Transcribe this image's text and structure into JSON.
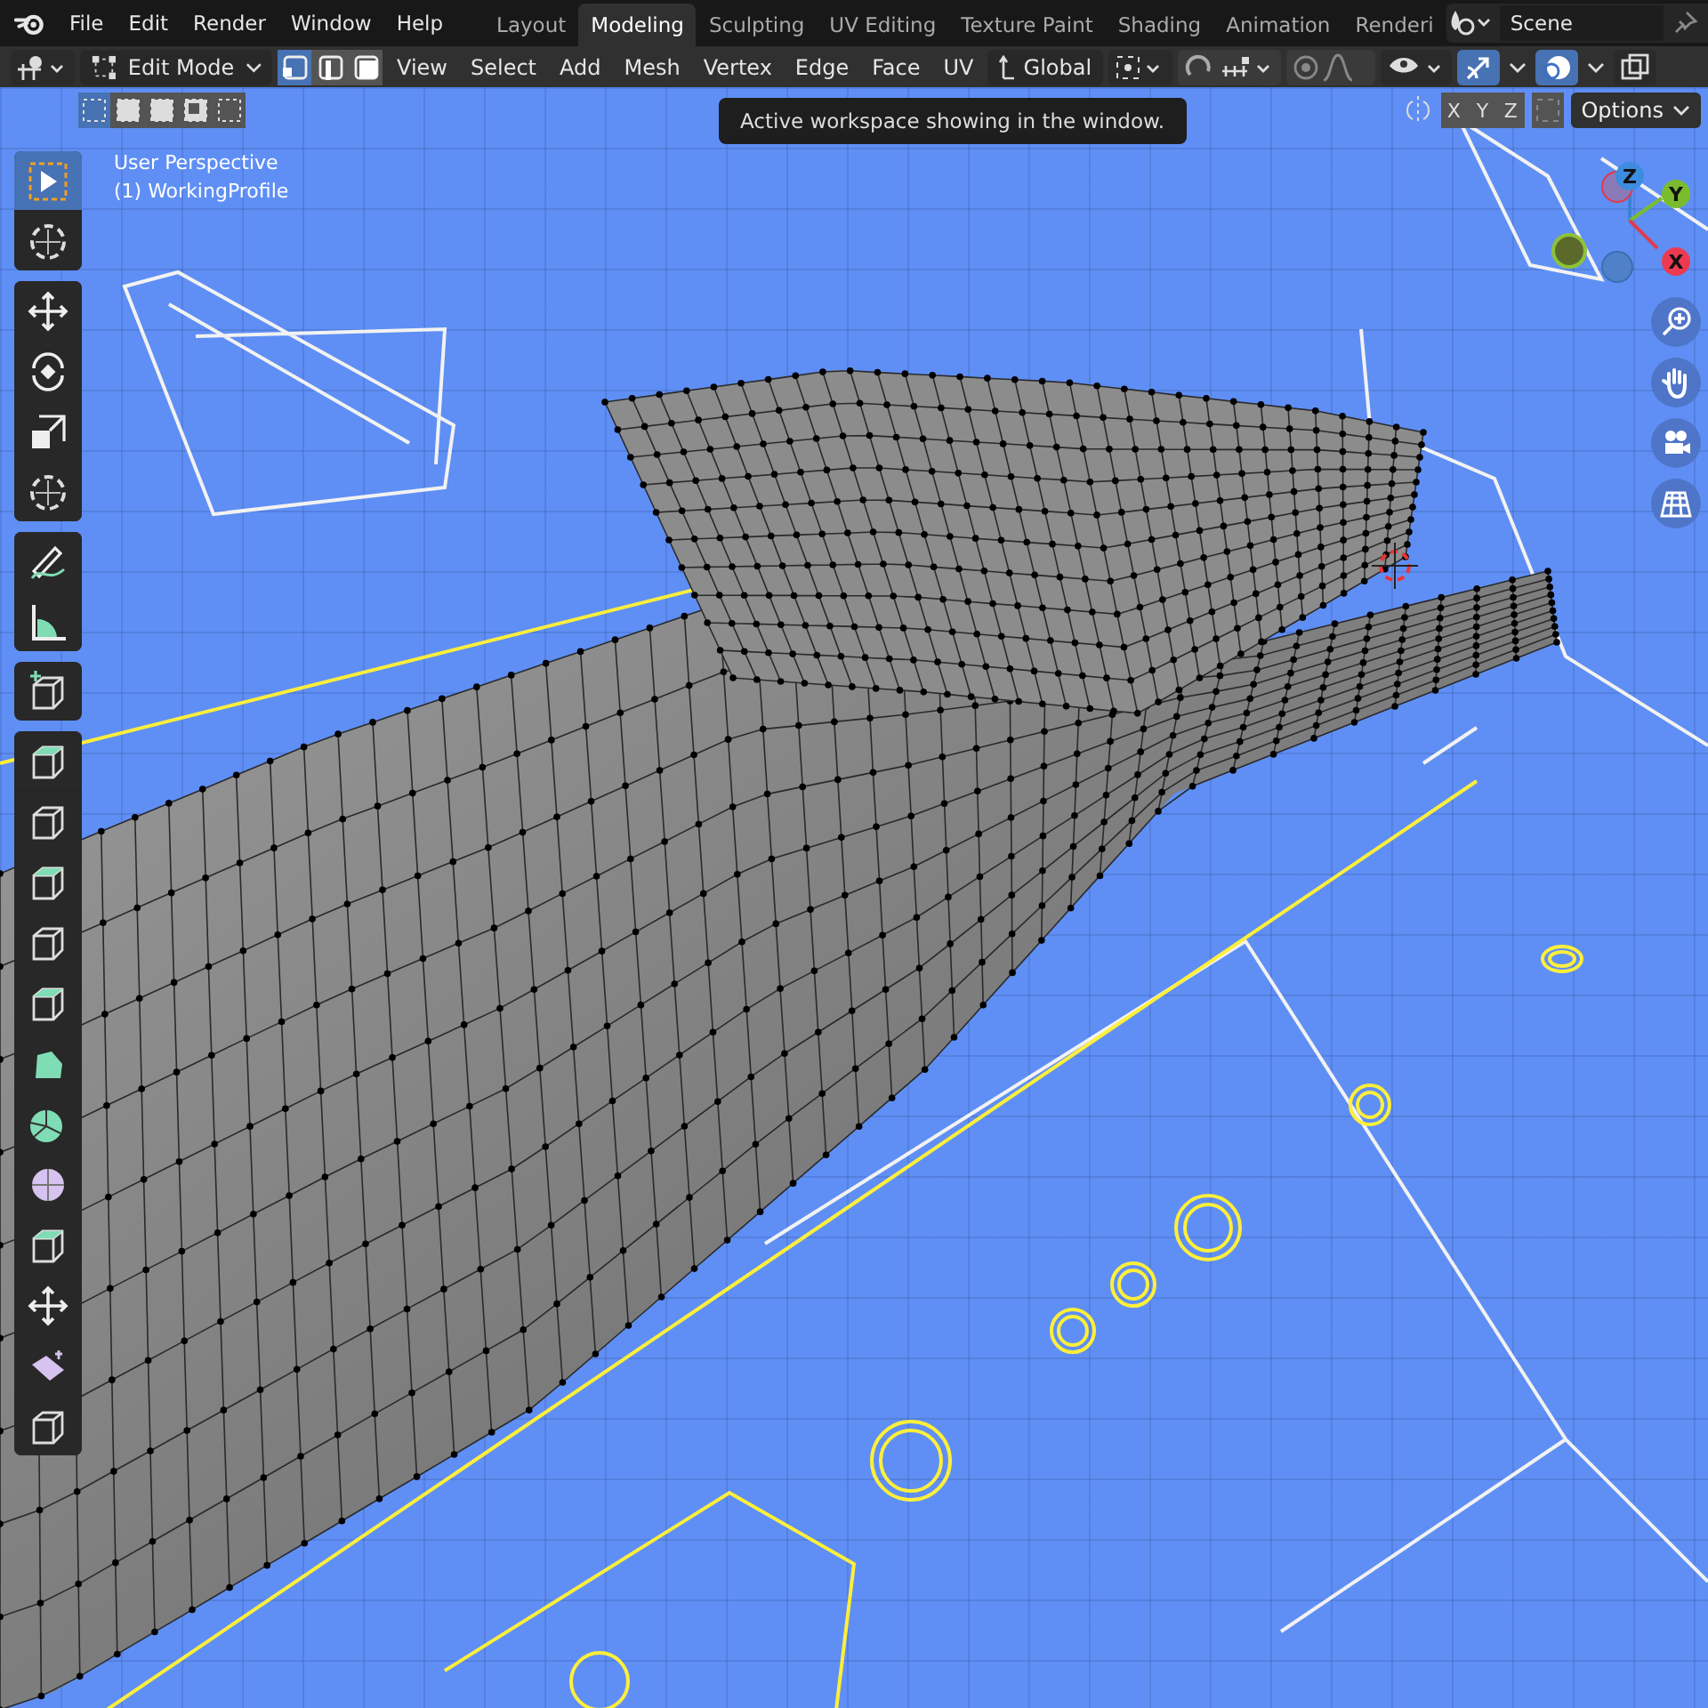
{
  "topbar": {
    "menus": [
      "File",
      "Edit",
      "Render",
      "Window",
      "Help"
    ],
    "tabs": [
      {
        "label": "Layout",
        "selected": false
      },
      {
        "label": "Modeling",
        "selected": true
      },
      {
        "label": "Sculpting",
        "selected": false
      },
      {
        "label": "UV Editing",
        "selected": false
      },
      {
        "label": "Texture Paint",
        "selected": false
      },
      {
        "label": "Shading",
        "selected": false
      },
      {
        "label": "Animation",
        "selected": false
      },
      {
        "label": "Renderi",
        "selected": false
      }
    ],
    "scene": "Scene"
  },
  "header": {
    "mode": "Edit Mode",
    "select_modes": [
      {
        "selected": true
      },
      {
        "selected": false
      },
      {
        "selected": false
      }
    ],
    "menus": [
      "View",
      "Select",
      "Add",
      "Mesh",
      "Vertex",
      "Edge",
      "Face",
      "UV"
    ],
    "orientation": "Global",
    "gizmos_on": true,
    "overlays_on": true
  },
  "selection_bar": {
    "modes": [
      {
        "selected": true
      },
      {
        "selected": false
      },
      {
        "selected": false
      },
      {
        "selected": false
      },
      {
        "selected": false
      }
    ],
    "mirror": [
      {
        "label": "X",
        "selected": false
      },
      {
        "label": "Y",
        "selected": false
      },
      {
        "label": "Z",
        "selected": false
      }
    ],
    "options": "Options"
  },
  "tooltip": "Active workspace showing in the window.",
  "viewport": {
    "view_name": "User Perspective",
    "object_name": "(1) WorkingProfile",
    "axes": [
      "Z",
      "Y",
      "X"
    ]
  },
  "toolbar": {
    "groups": [
      [
        {
          "selected": true
        },
        {
          "selected": false
        }
      ],
      [
        {
          "selected": false
        },
        {
          "selected": false
        },
        {
          "selected": false
        },
        {
          "selected": false
        }
      ],
      [
        {
          "selected": false
        },
        {
          "selected": false
        }
      ],
      [
        {
          "selected": false
        }
      ],
      [
        {
          "selected": false
        },
        {
          "selected": false
        },
        {
          "selected": false
        },
        {
          "selected": false
        },
        {
          "selected": false
        },
        {
          "selected": false
        },
        {
          "selected": false
        },
        {
          "selected": false
        },
        {
          "selected": false
        },
        {
          "selected": false
        },
        {
          "selected": false
        },
        {
          "selected": false
        }
      ]
    ]
  }
}
